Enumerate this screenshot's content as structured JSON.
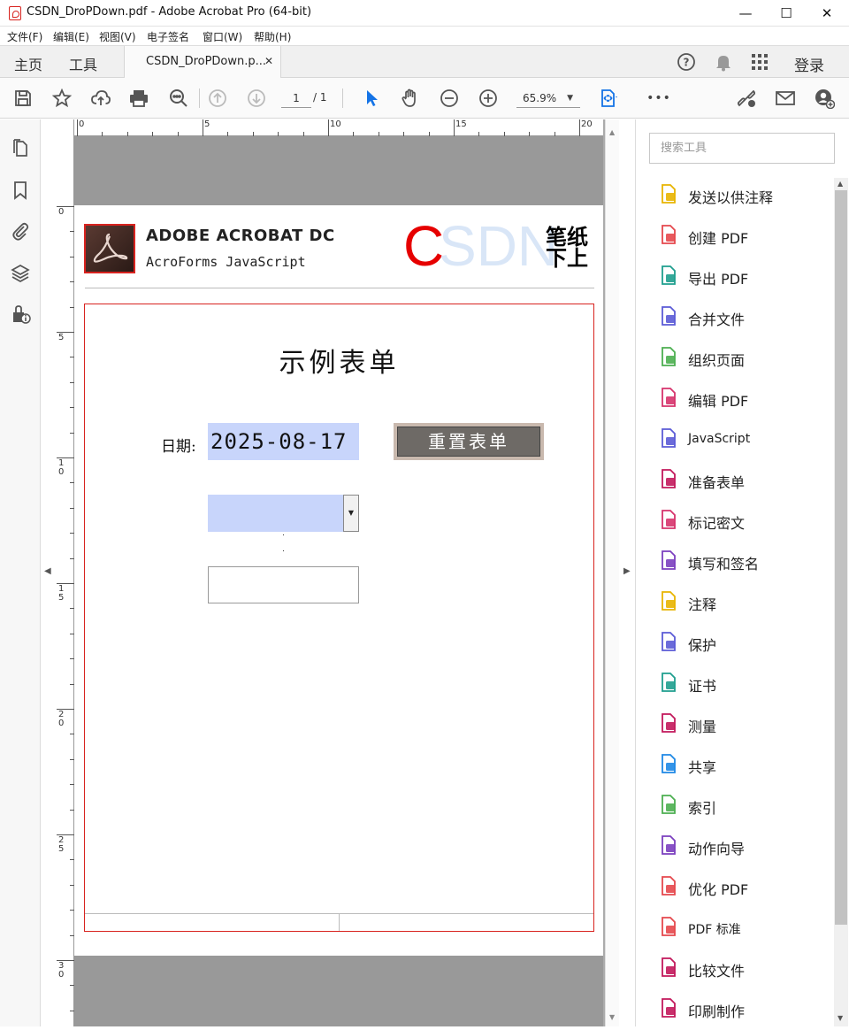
{
  "window": {
    "title": "CSDN_DroPDown.pdf - Adobe Acrobat Pro (64-bit)",
    "minimize": "—",
    "maximize": "☐",
    "close": "✕"
  },
  "menu": [
    "文件(F)",
    "编辑(E)",
    "视图(V)",
    "电子签名",
    "窗口(W)",
    "帮助(H)"
  ],
  "tabs": {
    "home": "主页",
    "tools": "工具",
    "document": "CSDN_DroPDown.p...",
    "close": "✕",
    "login": "登录"
  },
  "toolbar": {
    "page_current": "1",
    "page_total": "/ 1",
    "zoom": "65.9%",
    "zoom_dropdown": "▼",
    "more": "•••"
  },
  "ruler": {
    "h_labels": [
      "0",
      "5",
      "10",
      "15",
      "20"
    ],
    "v_labels": [
      "0",
      "5",
      "1\n0",
      "1\n5",
      "2\n0",
      "2\n5",
      "3\n0"
    ]
  },
  "document": {
    "brand_title": "ADOBE ACROBAT DC",
    "brand_subtitle": "AcroForms JavaScript",
    "csdn_c": "C",
    "csdn_rest": "SDN",
    "bijixia_line1": "笔纸",
    "bijixia_line2": "下上",
    "form_title": "示例表单",
    "date_label": "日期:",
    "date_value": "2025-08-17",
    "reset_button": "重置表单",
    "dropdown_value": "",
    "dropdown_arrow": "▼",
    "text_field_value": ""
  },
  "right_pane": {
    "search_placeholder": "搜索工具",
    "tools": [
      {
        "label": "发送以供注释",
        "icon": "send-for-comments-icon",
        "color": "#e8b400"
      },
      {
        "label": "创建 PDF",
        "icon": "create-pdf-icon",
        "color": "#e5484d"
      },
      {
        "label": "导出 PDF",
        "icon": "export-pdf-icon",
        "color": "#1f9e8e"
      },
      {
        "label": "合并文件",
        "icon": "combine-files-icon",
        "color": "#5b5bd6"
      },
      {
        "label": "组织页面",
        "icon": "organize-pages-icon",
        "color": "#4caf50"
      },
      {
        "label": "编辑 PDF",
        "icon": "edit-pdf-icon",
        "color": "#d6336c"
      },
      {
        "label": "JavaScript",
        "icon": "javascript-icon",
        "color": "#5b5bd6"
      },
      {
        "label": "准备表单",
        "icon": "prepare-form-icon",
        "color": "#c2185b"
      },
      {
        "label": "标记密文",
        "icon": "redact-icon",
        "color": "#d6336c"
      },
      {
        "label": "填写和签名",
        "icon": "fill-sign-icon",
        "color": "#7b3fbf"
      },
      {
        "label": "注释",
        "icon": "comment-icon",
        "color": "#e8b400"
      },
      {
        "label": "保护",
        "icon": "protect-icon",
        "color": "#5b5bd6"
      },
      {
        "label": "证书",
        "icon": "certificates-icon",
        "color": "#1f9e8e"
      },
      {
        "label": "测量",
        "icon": "measure-icon",
        "color": "#c2185b"
      },
      {
        "label": "共享",
        "icon": "share-icon",
        "color": "#1e88e5"
      },
      {
        "label": "索引",
        "icon": "index-icon",
        "color": "#4caf50"
      },
      {
        "label": "动作向导",
        "icon": "action-wizard-icon",
        "color": "#7b3fbf"
      },
      {
        "label": "优化 PDF",
        "icon": "optimize-pdf-icon",
        "color": "#e5484d"
      },
      {
        "label": "PDF 标准",
        "icon": "pdf-standards-icon",
        "color": "#e5484d"
      },
      {
        "label": "比较文件",
        "icon": "compare-files-icon",
        "color": "#c2185b"
      },
      {
        "label": "印刷制作",
        "icon": "print-production-icon",
        "color": "#c2185b"
      }
    ]
  },
  "colors": {
    "accent_blue": "#1473e6",
    "field_highlight": "#c8d5fb",
    "form_border": "#d8231f"
  }
}
